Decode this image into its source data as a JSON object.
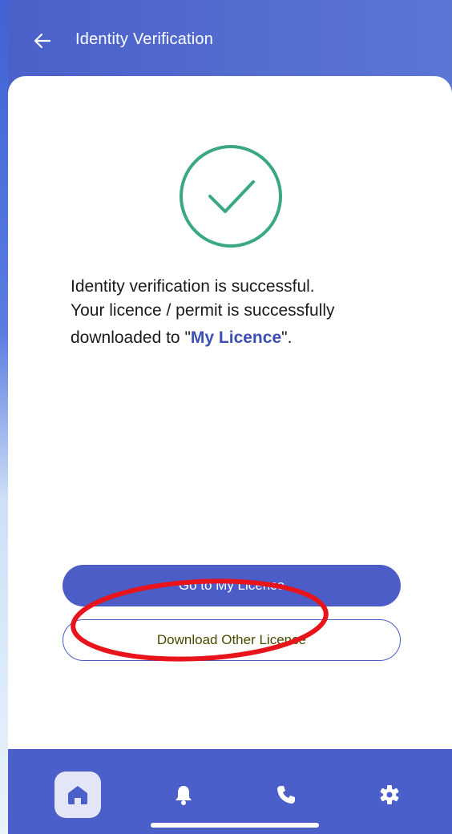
{
  "header": {
    "title": "Identity Verification",
    "back_icon": "arrow-left-icon"
  },
  "status": {
    "icon": "check-circle-icon",
    "icon_color": "#3aa97f"
  },
  "message": {
    "line1": "Identity verification is successful.",
    "line2": "Your licence / permit is successfully",
    "line3_prefix": "downloaded to \"",
    "line3_highlight": "My Licence",
    "line3_suffix": "\".",
    "highlight_color": "#3d4fb3"
  },
  "buttons": {
    "go_to_my_licence": "Go to My Licence",
    "download_other_licence": "Download Other Licence"
  },
  "annotation": {
    "shape": "ellipse",
    "color": "#e8141c"
  },
  "bottom_nav": {
    "items": [
      {
        "icon": "home-icon",
        "active": true
      },
      {
        "icon": "bell-icon",
        "active": false
      },
      {
        "icon": "phone-icon",
        "active": false
      },
      {
        "icon": "gear-icon",
        "active": false
      }
    ]
  },
  "colors": {
    "primary": "#4d5dc7",
    "header": "#5068cf",
    "nav": "#4a5fc9"
  }
}
